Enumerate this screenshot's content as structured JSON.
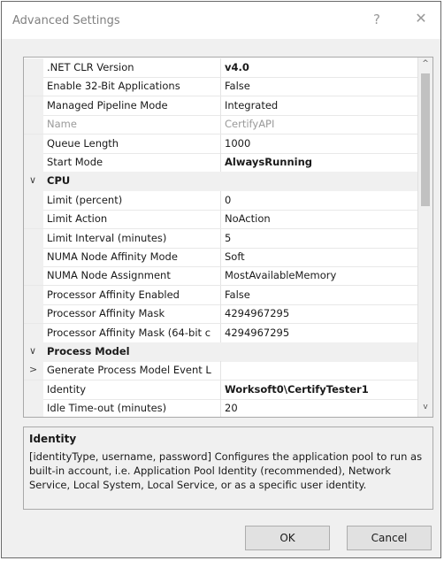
{
  "window": {
    "title": "Advanced Settings",
    "help_glyph": "?",
    "close_glyph": "✕"
  },
  "grid": {
    "rows": [
      {
        "type": "prop",
        "name": ".NET CLR Version",
        "value": "v4.0",
        "value_bold": true
      },
      {
        "type": "prop",
        "name": "Enable 32-Bit Applications",
        "value": "False"
      },
      {
        "type": "prop",
        "name": "Managed Pipeline Mode",
        "value": "Integrated"
      },
      {
        "type": "prop",
        "name": "Name",
        "value": "CertifyAPI",
        "disabled": true
      },
      {
        "type": "prop",
        "name": "Queue Length",
        "value": "1000"
      },
      {
        "type": "prop",
        "name": "Start Mode",
        "value": "AlwaysRunning",
        "value_bold": true
      },
      {
        "type": "cat",
        "name": "CPU",
        "glyph": "∨"
      },
      {
        "type": "prop",
        "name": "Limit (percent)",
        "value": "0"
      },
      {
        "type": "prop",
        "name": "Limit Action",
        "value": "NoAction"
      },
      {
        "type": "prop",
        "name": "Limit Interval (minutes)",
        "value": "5"
      },
      {
        "type": "prop",
        "name": "NUMA Node Affinity Mode",
        "value": "Soft"
      },
      {
        "type": "prop",
        "name": "NUMA Node Assignment",
        "value": "MostAvailableMemory"
      },
      {
        "type": "prop",
        "name": "Processor Affinity Enabled",
        "value": "False"
      },
      {
        "type": "prop",
        "name": "Processor Affinity Mask",
        "value": "4294967295"
      },
      {
        "type": "prop",
        "name": "Processor Affinity Mask (64-bit c",
        "value": "4294967295"
      },
      {
        "type": "cat",
        "name": "Process Model",
        "glyph": "∨"
      },
      {
        "type": "prop",
        "name": "Generate Process Model Event L",
        "value": "",
        "glyph": ">"
      },
      {
        "type": "prop",
        "name": "Identity",
        "value": "Worksoft0\\CertifyTester1",
        "value_bold": true,
        "selected": true
      },
      {
        "type": "prop",
        "name": "Idle Time-out (minutes)",
        "value": "20"
      }
    ]
  },
  "description": {
    "title": "Identity",
    "text": "[identityType, username, password] Configures the application pool to run as built-in account, i.e. Application Pool Identity (recommended), Network Service, Local System, Local Service, or as a specific user identity."
  },
  "buttons": {
    "ok": "OK",
    "cancel": "Cancel"
  },
  "scrollbar": {
    "up_glyph": "^",
    "down_glyph": "v"
  }
}
